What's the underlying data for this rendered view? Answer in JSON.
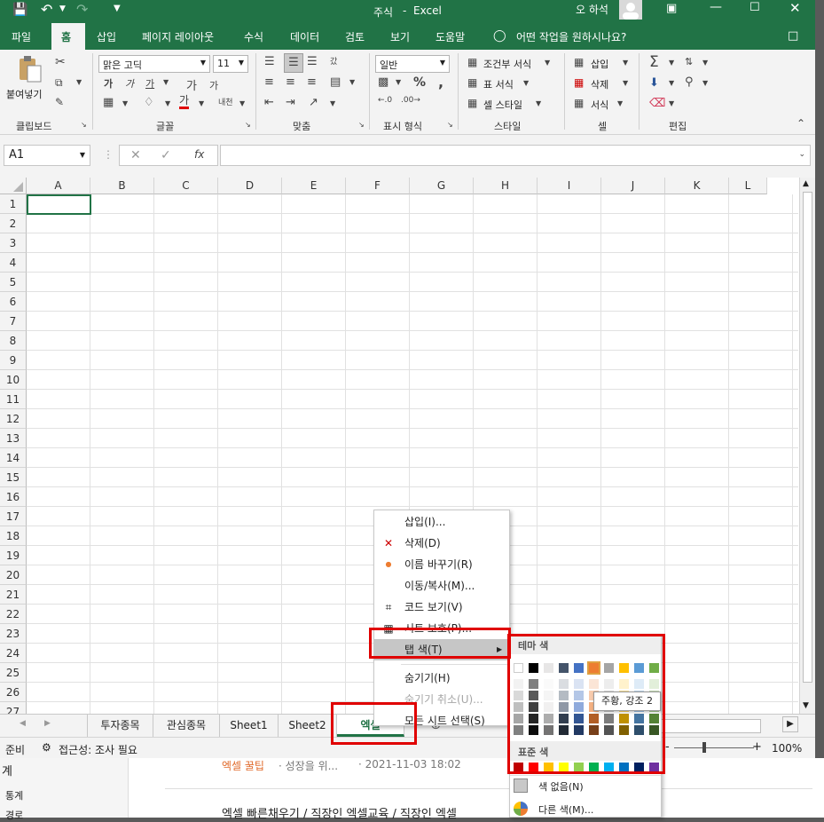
{
  "titlebar": {
    "doc_title": "주식",
    "app_sep": "-",
    "app_name": "Excel",
    "user": "오 하석"
  },
  "ribbon_tabs": [
    "파일",
    "홈",
    "삽입",
    "페이지 레이아웃",
    "수식",
    "데이터",
    "검토",
    "보기",
    "도움말"
  ],
  "tell_me": "어떤 작업을 원하시나요?",
  "clipboard": {
    "paste": "붙여넣기",
    "group": "클립보드"
  },
  "font": {
    "name": "맑은 고딕",
    "size": "11",
    "group": "글꼴",
    "bold": "가",
    "italic": "가",
    "underline": "가",
    "grow": "가",
    "shrink": "가",
    "color": "가",
    "phonetic": "내천"
  },
  "align": {
    "group": "맞춤",
    "wrap": "갔"
  },
  "number": {
    "format": "일반",
    "group": "표시 형식",
    "pct": "%",
    "comma": ","
  },
  "styles": {
    "cond": "조건부 서식",
    "table": "표 서식",
    "cell": "셀 스타일",
    "group": "스타일"
  },
  "cells": {
    "insert": "삽입",
    "delete": "삭제",
    "format": "서식",
    "group": "셀"
  },
  "editing": {
    "group": "편집"
  },
  "namebox": "A1",
  "fx": "fx",
  "columns": [
    "A",
    "B",
    "C",
    "D",
    "E",
    "F",
    "G",
    "H",
    "I",
    "J",
    "K",
    "L"
  ],
  "rows": [
    "1",
    "2",
    "3",
    "4",
    "5",
    "6",
    "7",
    "8",
    "9",
    "10",
    "11",
    "12",
    "13",
    "14",
    "15",
    "16",
    "17",
    "18",
    "19",
    "20",
    "21",
    "22",
    "23",
    "24",
    "25",
    "26",
    "27"
  ],
  "sheets": [
    "투자종목",
    "관심종목",
    "Sheet1",
    "Sheet2",
    "엑셀"
  ],
  "status": {
    "ready": "준비",
    "accessibility": "접근성: 조사 필요",
    "zoom": "100%",
    "minus": "-",
    "plus": "+"
  },
  "context_menu": [
    {
      "label": "삽입(I)...",
      "disabled": false,
      "icon": ""
    },
    {
      "label": "삭제(D)",
      "disabled": false,
      "icon": "delete-sheet-icon"
    },
    {
      "label": "이름 바꾸기(R)",
      "disabled": false,
      "icon": "bullet-icon"
    },
    {
      "label": "이동/복사(M)...",
      "disabled": false,
      "icon": ""
    },
    {
      "label": "코드 보기(V)",
      "disabled": false,
      "icon": "code-view-icon"
    },
    {
      "label": "시트 보호(P)...",
      "disabled": false,
      "icon": "protect-sheet-icon"
    },
    {
      "label": "탭 색(T)",
      "disabled": false,
      "icon": ""
    },
    {
      "label": "숨기기(H)",
      "disabled": false,
      "icon": ""
    },
    {
      "label": "숨기기 취소(U)...",
      "disabled": true,
      "icon": ""
    },
    {
      "label": "모든 시트 선택(S)",
      "disabled": false,
      "icon": ""
    }
  ],
  "palette": {
    "theme_title": "테마 색",
    "standard_title": "표준 색",
    "no_color": "색 없음(N)",
    "more_colors": "다른 색(M)...",
    "tooltip": "주황, 강조 2",
    "theme_top": [
      "#ffffff",
      "#000000",
      "#e7e6e6",
      "#44546a",
      "#4472c4",
      "#ed7d31",
      "#a5a5a5",
      "#ffc000",
      "#5b9bd5",
      "#70ad47"
    ],
    "standard": [
      "#c00000",
      "#ff0000",
      "#ffc000",
      "#ffff00",
      "#92d050",
      "#00b050",
      "#00b0f0",
      "#0070c0",
      "#002060",
      "#7030a0"
    ]
  },
  "bg_page": {
    "left1": "계",
    "left2": "통계",
    "left3": "경로",
    "cat": "엑셀 꿀팁",
    "post": "· 성장을 위...",
    "date": "· 2021-11-03 18:02",
    "next": "엑셀 빠른채우기 / 직장인 엑셀교육 / 직장인 엑셀"
  }
}
